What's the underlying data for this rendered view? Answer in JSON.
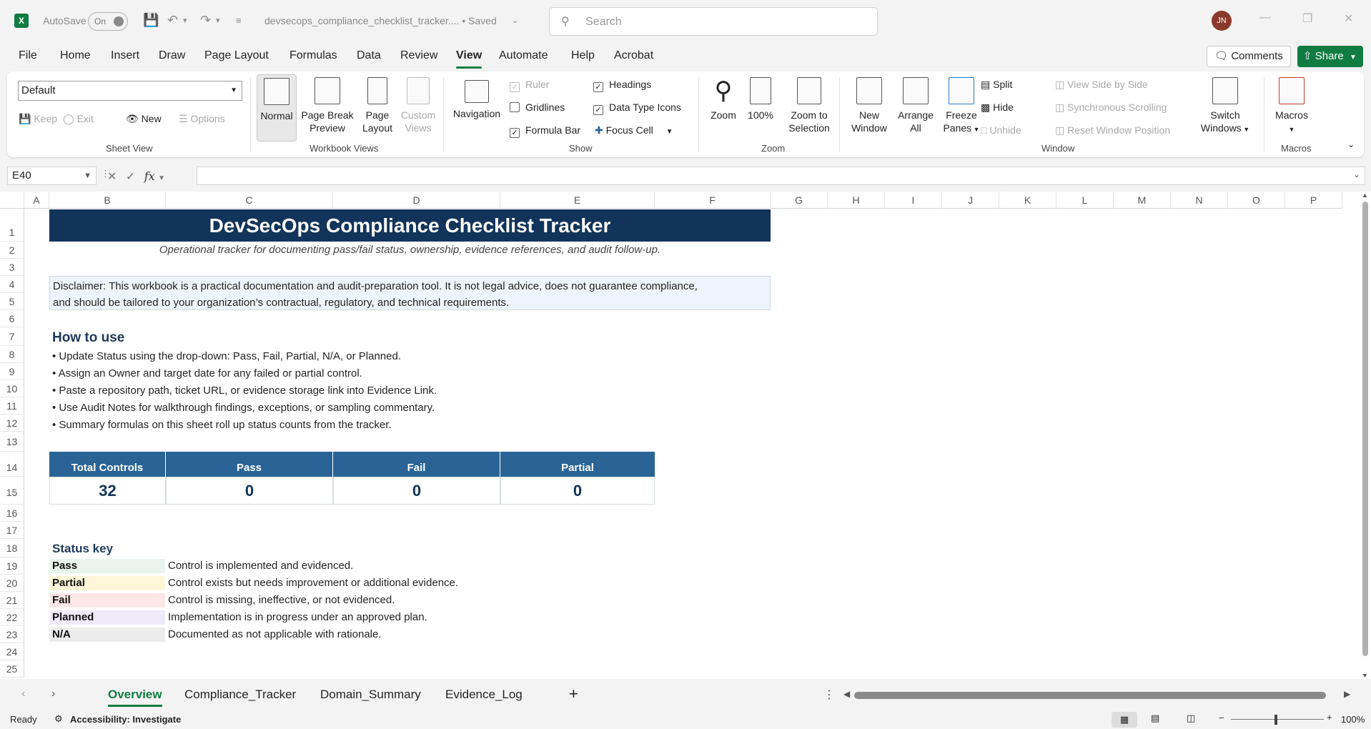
{
  "titlebar": {
    "app_badge": "X",
    "autosave_label": "AutoSave",
    "autosave_state": "On",
    "doc_title": "devsecops_compliance_checklist_tracker.... • Saved",
    "search_placeholder": "Search",
    "avatar_initials": "JN"
  },
  "menu": {
    "items": [
      "File",
      "Home",
      "Insert",
      "Draw",
      "Page Layout",
      "Formulas",
      "Data",
      "Review",
      "View",
      "Automate",
      "Help",
      "Acrobat"
    ],
    "active": "View",
    "comments_label": "Comments",
    "share_label": "Share"
  },
  "ribbon": {
    "sheet_view": {
      "select_value": "Default",
      "keep": "Keep",
      "exit": "Exit",
      "new": "New",
      "options": "Options",
      "label": "Sheet View"
    },
    "workbook_views": {
      "normal": "Normal",
      "page_break_1": "Page Break",
      "page_break_2": "Preview",
      "page_layout_1": "Page",
      "page_layout_2": "Layout",
      "custom_1": "Custom",
      "custom_2": "Views",
      "label": "Workbook Views"
    },
    "show": {
      "navigation": "Navigation",
      "ruler": "Ruler",
      "gridlines": "Gridlines",
      "formula_bar": "Formula Bar",
      "headings": "Headings",
      "data_type_icons": "Data Type Icons",
      "focus_cell": "Focus Cell",
      "label": "Show"
    },
    "zoom": {
      "zoom": "Zoom",
      "hundred": "100%",
      "zoom_sel_1": "Zoom to",
      "zoom_sel_2": "Selection",
      "label": "Zoom"
    },
    "window": {
      "new_1": "New",
      "new_2": "Window",
      "arrange_1": "Arrange",
      "arrange_2": "All",
      "freeze_1": "Freeze",
      "freeze_2": "Panes",
      "split": "Split",
      "hide": "Hide",
      "unhide": "Unhide",
      "side_by_side": "View Side by Side",
      "sync_scroll": "Synchronous Scrolling",
      "reset_pos": "Reset Window Position",
      "switch_1": "Switch",
      "switch_2": "Windows",
      "label": "Window"
    },
    "macros": {
      "macros": "Macros",
      "label": "Macros"
    }
  },
  "formula_bar": {
    "name_box": "E40",
    "fx": "fx",
    "value": ""
  },
  "grid": {
    "columns": [
      "A",
      "B",
      "C",
      "D",
      "E",
      "F",
      "G",
      "H",
      "I",
      "J",
      "K",
      "L",
      "M",
      "N",
      "O",
      "P"
    ],
    "rows": [
      "1",
      "2",
      "3",
      "4",
      "5",
      "6",
      "7",
      "8",
      "9",
      "10",
      "11",
      "12",
      "13",
      "14",
      "15",
      "16",
      "17",
      "18",
      "19",
      "20",
      "21",
      "22",
      "23",
      "24",
      "25"
    ],
    "title": "DevSecOps Compliance Checklist Tracker",
    "subtitle": "Operational tracker for documenting pass/fail status, ownership, evidence references, and audit follow-up.",
    "disclaimer_1": "Disclaimer: This workbook is a practical documentation and audit-preparation tool. It is not legal advice, does not guarantee compliance,",
    "disclaimer_2": "and should be tailored to your organization’s contractual, regulatory, and technical requirements.",
    "how_to_use_heading": "How to use",
    "how_to_use": [
      "• Update Status using the drop-down: Pass, Fail, Partial, N/A, or Planned.",
      "• Assign an Owner and target date for any failed or partial control.",
      "• Paste a repository path, ticket URL, or evidence storage link into Evidence Link.",
      "• Use Audit Notes for walkthrough findings, exceptions, or sampling commentary.",
      "• Summary formulas on this sheet roll up status counts from the tracker."
    ],
    "stats": {
      "headers": [
        "Total Controls",
        "Pass",
        "Fail",
        "Partial"
      ],
      "values": [
        "32",
        "0",
        "0",
        "0"
      ]
    },
    "status_key_heading": "Status key",
    "status_key": [
      {
        "label": "Pass",
        "desc": "Control is implemented and evidenced.",
        "color": "#eaf3ee"
      },
      {
        "label": "Partial",
        "desc": "Control exists but needs improvement or additional evidence.",
        "color": "#fff5d9"
      },
      {
        "label": "Fail",
        "desc": "Control is missing, ineffective, or not evidenced.",
        "color": "#fde7e7"
      },
      {
        "label": "Planned",
        "desc": "Implementation is in progress under an approved plan.",
        "color": "#eeeafa"
      },
      {
        "label": "N/A",
        "desc": "Documented as not applicable with rationale.",
        "color": "#ececec"
      }
    ]
  },
  "sheet_tabs": {
    "tabs": [
      "Overview",
      "Compliance_Tracker",
      "Domain_Summary",
      "Evidence_Log"
    ],
    "active": "Overview",
    "add": "+"
  },
  "statusbar": {
    "ready": "Ready",
    "accessibility": "Accessibility: Investigate",
    "zoom": "100%"
  },
  "colors": {
    "excel_green": "#107c41",
    "title_navy": "#12345a",
    "stat_header_blue": "#2a6496"
  }
}
